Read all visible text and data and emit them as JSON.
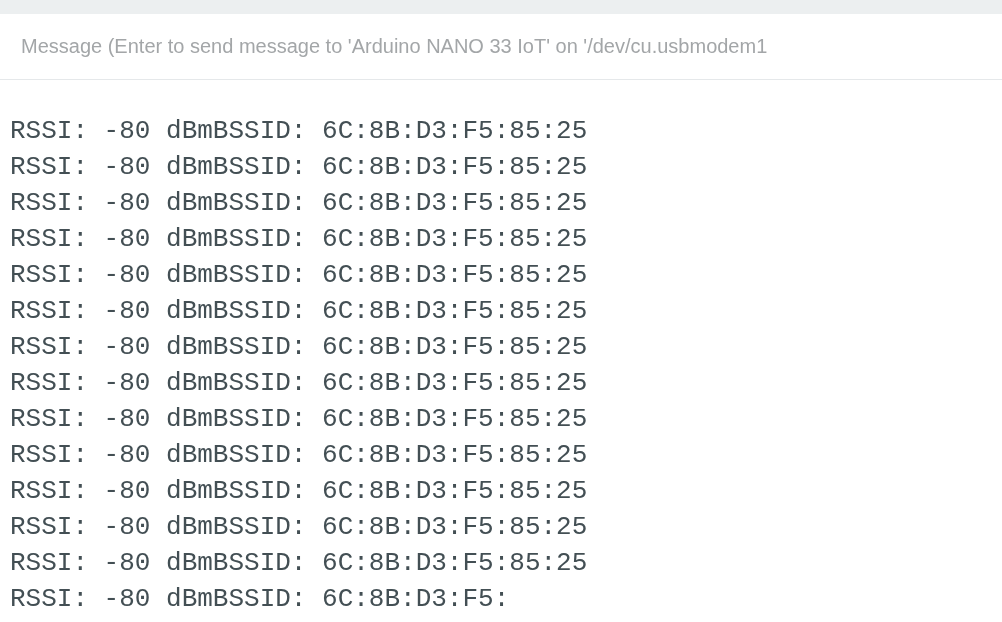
{
  "message_field": {
    "placeholder": "Message (Enter to send message to 'Arduino NANO 33 IoT' on '/dev/cu.usbmodem1"
  },
  "output_lines": [
    "RSSI: -80 dBmBSSID: 6C:8B:D3:F5:85:25",
    "RSSI: -80 dBmBSSID: 6C:8B:D3:F5:85:25",
    "RSSI: -80 dBmBSSID: 6C:8B:D3:F5:85:25",
    "RSSI: -80 dBmBSSID: 6C:8B:D3:F5:85:25",
    "RSSI: -80 dBmBSSID: 6C:8B:D3:F5:85:25",
    "RSSI: -80 dBmBSSID: 6C:8B:D3:F5:85:25",
    "RSSI: -80 dBmBSSID: 6C:8B:D3:F5:85:25",
    "RSSI: -80 dBmBSSID: 6C:8B:D3:F5:85:25",
    "RSSI: -80 dBmBSSID: 6C:8B:D3:F5:85:25",
    "RSSI: -80 dBmBSSID: 6C:8B:D3:F5:85:25",
    "RSSI: -80 dBmBSSID: 6C:8B:D3:F5:85:25",
    "RSSI: -80 dBmBSSID: 6C:8B:D3:F5:85:25",
    "RSSI: -80 dBmBSSID: 6C:8B:D3:F5:85:25",
    "RSSI: -80 dBmBSSID: 6C:8B:D3:F5:"
  ]
}
